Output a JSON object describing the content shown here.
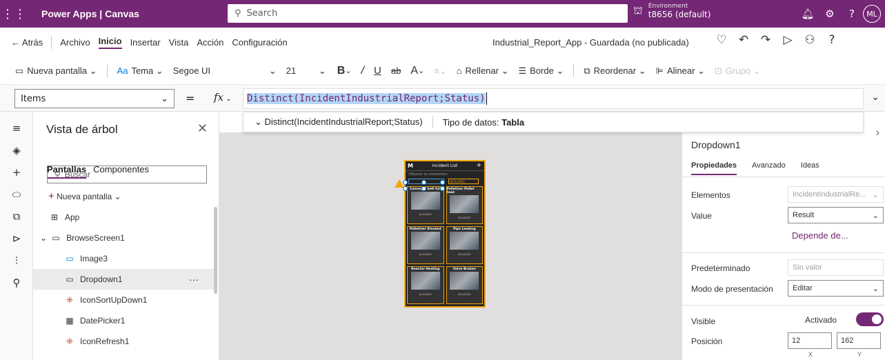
{
  "topbar": {
    "app_name": "Power Apps | Canvas",
    "search_placeholder": "Search",
    "env_label": "Environment",
    "env_value": "t8656 (default)",
    "avatar": "ML"
  },
  "menu": {
    "back": "Atrás",
    "items": [
      "Archivo",
      "Inicio",
      "Insertar",
      "Vista",
      "Acción",
      "Configuración"
    ],
    "active": "Inicio",
    "app_title": "Industrial_Report_App - Guardada (no publicada)"
  },
  "ribbon": {
    "new_screen": "Nueva pantalla",
    "theme": "Tema",
    "font": "Segoe UI",
    "size": "21",
    "fill": "Rellenar",
    "border": "Borde",
    "reorder": "Reordenar",
    "align": "Alinear",
    "group": "Grupo"
  },
  "formula": {
    "property": "Items",
    "expression": "Distinct(IncidentIndustrialReport;Status)",
    "hint_expr": "Distinct(IncidentIndustrialReport;Status)",
    "hint_type_label": "Tipo de datos:",
    "hint_type_value": "Tabla"
  },
  "tree": {
    "title": "Vista de árbol",
    "tab_screens": "Pantallas",
    "tab_components": "Componentes",
    "search_placeholder": "Buscar",
    "new_screen": "Nueva pantalla",
    "nodes": [
      "App",
      "BrowseScreen1",
      "Image3",
      "Dropdown1",
      "IconSortUpDown1",
      "DatePicker1",
      "IconRefresh1"
    ]
  },
  "preview": {
    "header": "Incident List",
    "search": "Buscar en elementos",
    "date": "8/11/2023",
    "tiles": [
      "Conveyor belt full",
      "Palletizer Pallet feed",
      "Palletizer Stucked",
      "Pipe Leaking",
      "Reactor Heating",
      "Valve Broken"
    ],
    "tile_dates": [
      "8/11/2022",
      "8/11/2022",
      "8/11/2022",
      "8/11/2022",
      "8/11/2022",
      "8/11/2022"
    ],
    "tile_status": "Opened"
  },
  "props": {
    "control_name": "Dropdown1",
    "tabs": [
      "Propiedades",
      "Avanzado",
      "Ideas"
    ],
    "items_label": "Elementos",
    "items_value": "IncidentIndustrialRe...",
    "value_label": "Value",
    "value_value": "Result",
    "depends": "Depende de...",
    "default_label": "Predeterminado",
    "default_value": "Sin valor",
    "mode_label": "Modo de presentación",
    "mode_value": "Editar",
    "visible_label": "Visible",
    "visible_value": "Activado",
    "position_label": "Posición",
    "pos_x": "12",
    "pos_y": "162",
    "x_label": "X",
    "y_label": "Y"
  },
  "colors": {
    "brand": "#742774",
    "selection": "#0078d4",
    "warning": "#f2a60d"
  }
}
